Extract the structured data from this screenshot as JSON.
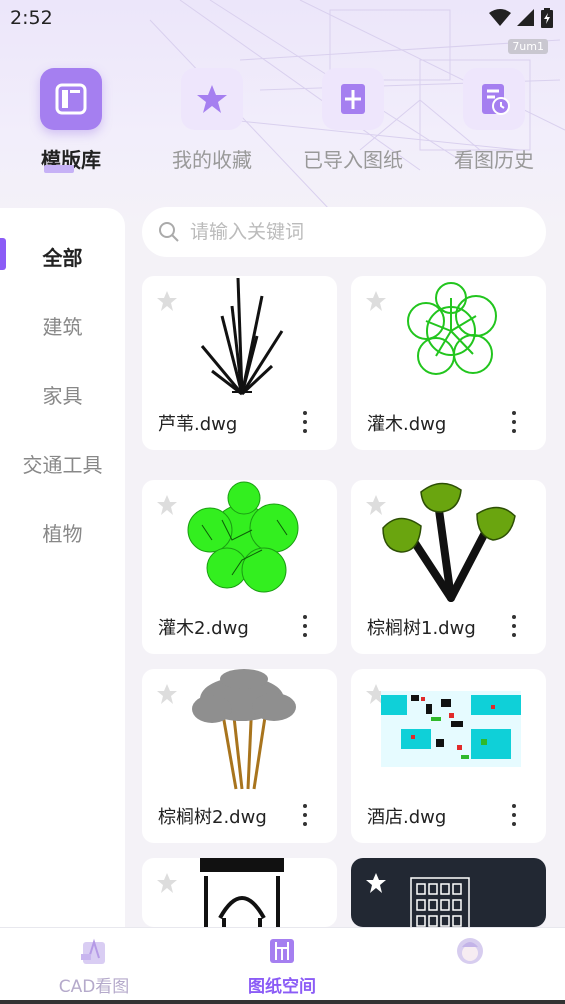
{
  "status_bar": {
    "time": "2:52",
    "build_tag": "7um1"
  },
  "top_tabs": [
    {
      "label": "模版库",
      "icon": "template-icon",
      "selected": true
    },
    {
      "label": "我的收藏",
      "icon": "star-icon",
      "selected": false
    },
    {
      "label": "已导入图纸",
      "icon": "import-icon",
      "selected": false
    },
    {
      "label": "看图历史",
      "icon": "history-icon",
      "selected": false
    }
  ],
  "sidebar": {
    "items": [
      {
        "label": "全部",
        "active": true
      },
      {
        "label": "建筑",
        "active": false
      },
      {
        "label": "家具",
        "active": false
      },
      {
        "label": "交通工具",
        "active": false
      },
      {
        "label": "植物",
        "active": false
      }
    ]
  },
  "search": {
    "placeholder": "请输入关键词",
    "value": ""
  },
  "cards": [
    {
      "name": "芦苇.dwg",
      "thumbnail": "reed-drawing"
    },
    {
      "name": "灌木.dwg",
      "thumbnail": "shrub-drawing"
    },
    {
      "name": "灌木2.dwg",
      "thumbnail": "shrub2-drawing"
    },
    {
      "name": "棕榈树1.dwg",
      "thumbnail": "palm1-drawing"
    },
    {
      "name": "棕榈树2.dwg",
      "thumbnail": "palm2-drawing"
    },
    {
      "name": "酒店.dwg",
      "thumbnail": "hotel-plan-drawing"
    },
    {
      "name": "",
      "thumbnail": "building-facade-drawing"
    },
    {
      "name": "",
      "thumbnail": "building-elevation-drawing"
    }
  ],
  "bottom_nav": [
    {
      "label": "CAD看图",
      "icon": "cad-viewer-icon",
      "active": false
    },
    {
      "label": "图纸空间",
      "icon": "drawing-space-icon",
      "active": true
    },
    {
      "label": "",
      "icon": "profile-avatar-icon",
      "active": false
    }
  ],
  "colors": {
    "accent": "#8b5cf6",
    "tile_active": "#a57ff0",
    "tile_inactive": "#eee6fc"
  }
}
